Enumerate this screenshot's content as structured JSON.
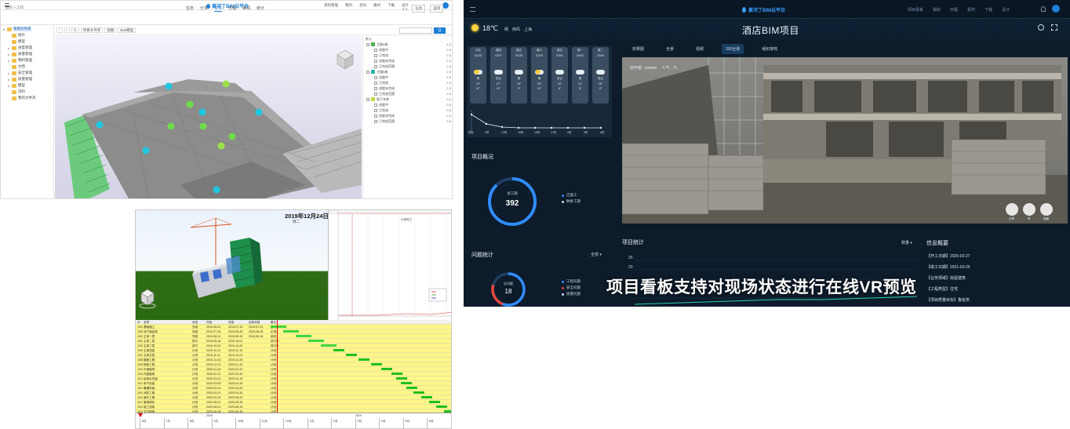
{
  "bim": {
    "header": {
      "logo": "黄河丁BIM云平台",
      "menu": [
        "资料管理",
        "我的",
        "合同",
        "素材",
        "下载",
        "设计"
      ],
      "avatar": "G"
    },
    "crumb": "首页 > 工作",
    "tabs": [
      "任务",
      "分享",
      "文件",
      "日程",
      "审阅",
      "统计"
    ],
    "active_tab": "文件",
    "right_tools": [
      "≡ 1",
      "任务",
      "菜单"
    ],
    "tree": [
      {
        "label": "项目文件夹",
        "level": 0,
        "caret": "▾",
        "selected": true
      },
      {
        "label": "图片",
        "level": 1,
        "caret": ""
      },
      {
        "label": "模型",
        "level": 1,
        "caret": ""
      },
      {
        "label": "进度管理",
        "level": 1,
        "caret": "▸"
      },
      {
        "label": "质量管理",
        "level": 1,
        "caret": "▸"
      },
      {
        "label": "物料管理",
        "level": 1,
        "caret": "▸"
      },
      {
        "label": "文档",
        "level": 1,
        "caret": ""
      },
      {
        "label": "安全管理",
        "level": 1,
        "caret": "▸"
      },
      {
        "label": "质量管理",
        "level": 1,
        "caret": "▸"
      },
      {
        "label": "模型",
        "level": 1,
        "caret": "▸"
      },
      {
        "label": "资料",
        "level": 1,
        "caret": ""
      },
      {
        "label": "我的文件夹",
        "level": 1,
        "caret": ""
      }
    ],
    "viewbar": [
      "项目文件夹",
      "视图",
      "BIM模型"
    ],
    "search_btn": "Q",
    "props_head": "默认",
    "props": [
      {
        "type": "group",
        "label": "主楼A栋",
        "color": "#4caf50",
        "val": "4-0"
      },
      {
        "type": "item",
        "label": "进度中",
        "val": "0-5"
      },
      {
        "type": "item",
        "label": "已完成",
        "val": "0-5"
      },
      {
        "type": "item",
        "label": "进度未完成",
        "val": "2-5"
      },
      {
        "type": "item",
        "label": "已完成范围",
        "val": "2-5"
      },
      {
        "type": "group",
        "label": "主楼B栋",
        "color": "#2bb5a8",
        "val": "2-5"
      },
      {
        "type": "item",
        "label": "进度中",
        "val": "2-5"
      },
      {
        "type": "item",
        "label": "已完成",
        "val": "2-5"
      },
      {
        "type": "item",
        "label": "进度未完成",
        "val": "2-5"
      },
      {
        "type": "item",
        "label": "已完成范围",
        "val": "2-5"
      },
      {
        "type": "group",
        "label": "地下车库",
        "color": "#c6d63a",
        "val": "0-5"
      },
      {
        "type": "item",
        "label": "进度中",
        "val": "0-5"
      },
      {
        "type": "item",
        "label": "已完成",
        "val": "0-5"
      },
      {
        "type": "item",
        "label": "进度未完成",
        "val": "0-5"
      },
      {
        "type": "item",
        "label": "已完成范围",
        "val": "0-5"
      }
    ]
  },
  "schedule": {
    "date": "2019年12月24日",
    "date_sub": "周二",
    "chart_note": "计划完工",
    "columns": [
      "ID",
      "名称",
      "状态",
      "开始",
      "完成",
      "实际完成",
      "备注"
    ],
    "rows": [
      [
        "1001",
        "基础施工",
        "完成",
        "2019-06-01",
        "2019-07-15",
        "2019-07-12",
        "正常"
      ],
      [
        "1002",
        "地下室结构",
        "完成",
        "2019-07-16",
        "2019-08-30",
        "2019-08-28",
        "正常"
      ],
      [
        "1003",
        "主体一层",
        "完成",
        "2019-08-31",
        "2019-09-15",
        "2019-09-16",
        "延迟"
      ],
      [
        "1004",
        "主体二层",
        "进行",
        "2019-09-16",
        "2019-10-01",
        "",
        "进行中"
      ],
      [
        "1005",
        "主体三层",
        "进行",
        "2019-10-02",
        "2019-10-20",
        "",
        "进行中"
      ],
      [
        "1006",
        "主体四层",
        "计划",
        "2019-10-21",
        "2019-11-10",
        "",
        "计划"
      ],
      [
        "1007",
        "主体五层",
        "计划",
        "2019-11-11",
        "2019-12-01",
        "",
        "计划"
      ],
      [
        "1008",
        "屋面工程",
        "计划",
        "2019-12-02",
        "2019-12-20",
        "",
        "计划"
      ],
      [
        "1009",
        "砌体工程",
        "计划",
        "2019-12-21",
        "2020-01-15",
        "",
        "计划"
      ],
      [
        "1010",
        "外墙装饰",
        "计划",
        "2020-01-16",
        "2020-02-20",
        "",
        "计划"
      ],
      [
        "1011",
        "内部装修",
        "计划",
        "2020-02-21",
        "2020-03-30",
        "",
        "计划"
      ],
      [
        "1012",
        "给排水安装",
        "计划",
        "2020-03-01",
        "2020-04-10",
        "",
        "计划"
      ],
      [
        "1013",
        "电气安装",
        "计划",
        "2020-03-05",
        "2020-04-15",
        "",
        "计划"
      ],
      [
        "1014",
        "暖通安装",
        "计划",
        "2020-03-10",
        "2020-04-20",
        "",
        "计划"
      ],
      [
        "1015",
        "消防工程",
        "计划",
        "2020-04-01",
        "2020-04-30",
        "",
        "计划"
      ],
      [
        "1016",
        "室外工程",
        "计划",
        "2020-04-15",
        "2020-05-20",
        "",
        "计划"
      ],
      [
        "1017",
        "景观绿化",
        "计划",
        "2020-05-01",
        "2020-05-30",
        "",
        "计划"
      ],
      [
        "1018",
        "竣工验收",
        "计划",
        "2020-06-01",
        "2020-06-15",
        "",
        "计划"
      ],
      [
        "1019",
        "交付使用",
        "计划",
        "2020-06-16",
        "2020-06-30",
        "",
        "计划"
      ]
    ],
    "timeline_years": [
      "2019",
      "2020"
    ],
    "timeline_months": [
      "6月",
      "7月",
      "8月",
      "9月",
      "10月",
      "11月",
      "12月",
      "1月",
      "2月",
      "3月",
      "4月",
      "5月",
      "6月"
    ]
  },
  "dashboard": {
    "header": {
      "logo": "黄河丁BIM云平台",
      "menu": [
        "项目看板",
        "我的",
        "日程",
        "素材",
        "下载",
        "设计"
      ]
    },
    "weather": {
      "temp": "18℃",
      "desc": [
        "晴",
        "西风",
        "上海"
      ]
    },
    "title": "酒店BIM项目",
    "tabs": [
      "效果图",
      "全景",
      "视频",
      "360全景",
      "组织架构"
    ],
    "active_tab": "360全景",
    "forecast": [
      {
        "day": "今天",
        "date": "02/26",
        "w": "晴",
        "hi": "19°",
        "lo": "11°",
        "sunny": true
      },
      {
        "day": "周四",
        "date": "02/27",
        "w": "多云",
        "hi": "17°",
        "lo": "10°",
        "sunny": false
      },
      {
        "day": "周五",
        "date": "02/28",
        "w": "阴",
        "hi": "16°",
        "lo": "9°",
        "sunny": false
      },
      {
        "day": "周六",
        "date": "02/29",
        "w": "晴",
        "hi": "18°",
        "lo": "10°",
        "sunny": true
      },
      {
        "day": "周日",
        "date": "03/01",
        "w": "多云",
        "hi": "15°",
        "lo": "8°",
        "sunny": false
      },
      {
        "day": "周一",
        "date": "03/02",
        "w": "阴",
        "hi": "14°",
        "lo": "8°",
        "sunny": false
      },
      {
        "day": "周二",
        "date": "03/03",
        "w": "多云",
        "hi": "16°",
        "lo": "9°",
        "sunny": false
      }
    ],
    "forecast_hours": [
      "现在",
      "9时",
      "12时",
      "15时",
      "18时",
      "21时",
      "0时",
      "3时",
      "6时"
    ],
    "overview": {
      "title": "项目概况",
      "label": "总工期",
      "value": "392",
      "legend": [
        "已施工",
        "剩余工期"
      ]
    },
    "issues": {
      "title": "问题统计",
      "select": "全部 ▾",
      "label": "总问题",
      "value": "18",
      "legend": [
        "工程问题",
        "安全问题",
        "质量问题"
      ]
    },
    "photo": {
      "info": [
        "创作者 : wiewm",
        "人气 : 71"
      ],
      "buttons": [
        "分享",
        "赞",
        "收藏"
      ]
    },
    "stats": {
      "title": "项目统计",
      "select": "数量 ▾",
      "y_ticks": [
        "25",
        "20"
      ]
    },
    "info": {
      "title": "信息概要",
      "rows": [
        "【开工日期】2020-02-27",
        "【竣工日期】2021-03-25",
        "【业务领域】房屋建筑",
        "【工程类型】住宅",
        "【项目质量目标】鲁班奖"
      ]
    },
    "caption": "项目看板支持对现场状态进行在线VR预览"
  },
  "colors": {
    "accent": "#1d7fd6",
    "dash_bg": "#0d1b2a",
    "gantt_green": "#3fd43f",
    "table_yellow": "#fff68a"
  }
}
